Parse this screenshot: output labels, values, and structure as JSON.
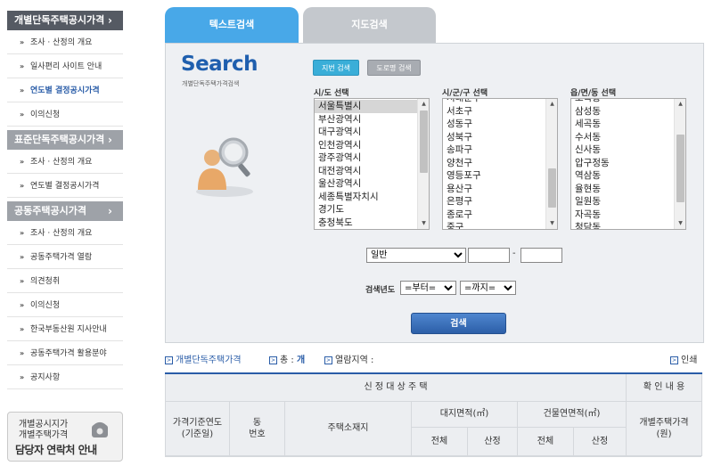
{
  "sidebar": {
    "sections": [
      {
        "title": "개별단독주택공시가격",
        "chevron": "›",
        "style": "dark",
        "items": [
          {
            "label": "조사 · 산정의 개요",
            "active": false
          },
          {
            "label": "일사편리 사이트 안내",
            "active": false
          },
          {
            "label": "연도별 결정공시가격",
            "active": true
          },
          {
            "label": "이의신청",
            "active": false
          }
        ]
      },
      {
        "title": "표준단독주택공시가격",
        "chevron": "›",
        "style": "light",
        "items": [
          {
            "label": "조사 · 산정의 개요",
            "active": false
          },
          {
            "label": "연도별 결정공시가격",
            "active": false
          }
        ]
      },
      {
        "title": "공동주택공시가격",
        "chevron": "›",
        "style": "light",
        "items": [
          {
            "label": "조사 · 산정의 개요",
            "active": false
          },
          {
            "label": "공동주택가격 열람",
            "active": false
          },
          {
            "label": "의견청취",
            "active": false
          },
          {
            "label": "이의신청",
            "active": false
          },
          {
            "label": "한국부동산원 지사안내",
            "active": false
          },
          {
            "label": "공동주택가격 활용분야",
            "active": false
          },
          {
            "label": "공지사항",
            "active": false
          }
        ]
      }
    ],
    "bullet": "»",
    "contact": {
      "line1": "개별공시지가",
      "line2": "개별주택가격",
      "line3": "담당자 연락처 안내",
      "icon": "phone-icon"
    }
  },
  "tabs": [
    {
      "label": "텍스트검색",
      "active": true
    },
    {
      "label": "지도검색",
      "active": false
    }
  ],
  "search": {
    "logo": "Search",
    "subtitle": "개별단독주택가격검색",
    "mode_buttons": {
      "jibun": "지번 검색",
      "road": "도로명 검색"
    },
    "labels": {
      "sido": "시/도 선택",
      "sigungu": "시/군/구 선택",
      "dong": "읍/면/동 선택",
      "year": "검색년도"
    },
    "sido_list": [
      "서울특별시",
      "부산광역시",
      "대구광역시",
      "인천광역시",
      "광주광역시",
      "대전광역시",
      "울산광역시",
      "세종특별자치시",
      "경기도",
      "충청북도"
    ],
    "sido_selected": 0,
    "sigungu_list": [
      "서대문구",
      "서초구",
      "성동구",
      "성북구",
      "송파구",
      "양천구",
      "영등포구",
      "용산구",
      "은평구",
      "종로구",
      "중구"
    ],
    "dong_list": [
      "오곡동",
      "삼성동",
      "세곡동",
      "수서동",
      "신사동",
      "압구정동",
      "역삼동",
      "율현동",
      "일원동",
      "자곡동",
      "청담동"
    ],
    "gubun_value": "일반",
    "range_dash": "-",
    "year_from": "=부터=",
    "year_to": "=까지=",
    "submit_label": "검색"
  },
  "info": {
    "type_label": "개별단독주택가격",
    "total_label": "총 :",
    "total_unit": "개",
    "region_label": "열람지역 :",
    "print_label": "인쇄"
  },
  "table": {
    "group_header": "신 정 대 상 주 택",
    "confirm_header": "확 인 내 용",
    "col_year": "가격기준연도\n(기준일)",
    "col_dong": "동\n번호",
    "col_address": "주택소재지",
    "col_land_area": "대지면적(㎡)",
    "col_building_area": "건물연면적(㎡)",
    "col_total_1": "전체",
    "col_calc_1": "산정",
    "col_total_2": "전체",
    "col_calc_2": "산정",
    "col_price": "개별주택가격\n(원)"
  }
}
